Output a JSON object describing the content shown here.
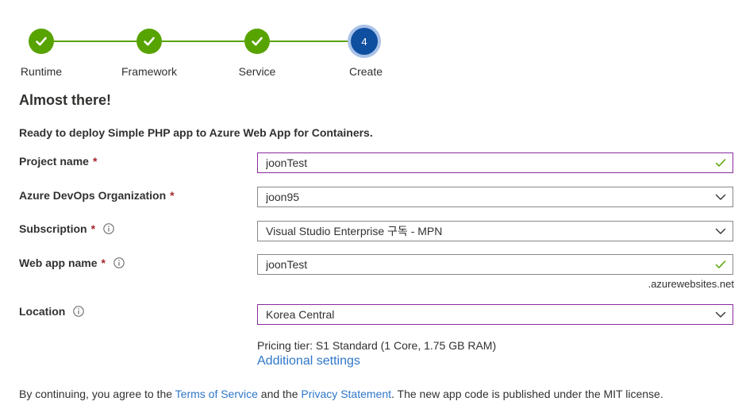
{
  "stepper": {
    "steps": [
      {
        "label": "Runtime",
        "state": "complete",
        "icon": "checkmark-icon"
      },
      {
        "label": "Framework",
        "state": "complete",
        "icon": "checkmark-icon"
      },
      {
        "label": "Service",
        "state": "complete",
        "icon": "checkmark-icon"
      },
      {
        "label": "Create",
        "state": "current",
        "number": "4"
      }
    ],
    "complete_color": "#57a300",
    "current_color": "#0f4fa0"
  },
  "heading": "Almost there!",
  "intro": "Ready to deploy Simple PHP app to Azure Web App for Containers.",
  "form": {
    "project_name": {
      "label": "Project name",
      "required": "*",
      "value": "joonTest",
      "status_icon": "checkmark-icon"
    },
    "organization": {
      "label": "Azure DevOps Organization",
      "required": "*",
      "value": "joon95",
      "icon": "chevron-down-icon"
    },
    "subscription": {
      "label": "Subscription",
      "required": "*",
      "value": "Visual Studio Enterprise 구독 - MPN",
      "icon": "chevron-down-icon"
    },
    "web_app_name": {
      "label": "Web app name",
      "required": "*",
      "value": "joonTest",
      "suffix": ".azurewebsites.net",
      "status_icon": "checkmark-icon"
    },
    "location": {
      "label": "Location",
      "value": "Korea Central",
      "icon": "chevron-down-icon"
    }
  },
  "pricing_tier": "Pricing tier: S1 Standard (1 Core, 1.75 GB RAM)",
  "additional_settings": "Additional settings",
  "footer": {
    "prefix": "By continuing, you agree to the ",
    "terms_link": "Terms of Service",
    "middle": " and the ",
    "privacy_link": "Privacy Statement",
    "suffix": ". The new app code is published under the MIT license."
  },
  "colors": {
    "accent_border": "#8a2b9f",
    "link": "#2f77c9",
    "required": "#a4262c",
    "valid": "#57a300"
  }
}
